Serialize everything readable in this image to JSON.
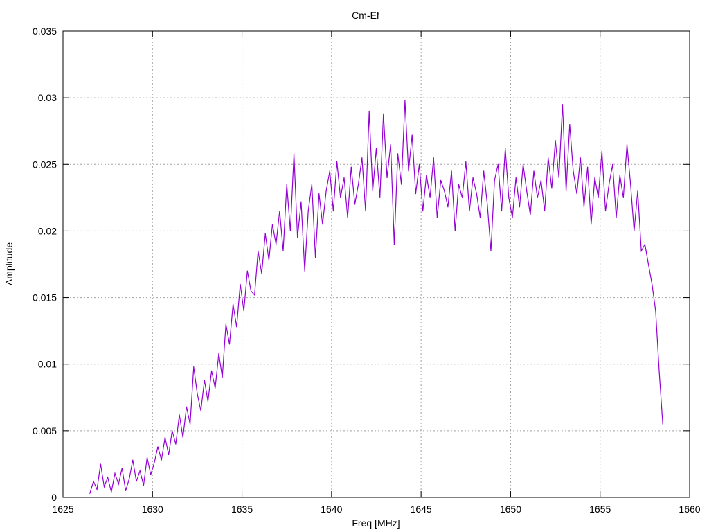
{
  "chart_data": {
    "type": "line",
    "title": "Cm-Ef",
    "xlabel": "Freq [MHz]",
    "ylabel": "Amplitude",
    "xlim": [
      1625,
      1660
    ],
    "ylim": [
      0,
      0.035
    ],
    "xticks": [
      "1625",
      "1630",
      "1635",
      "1640",
      "1645",
      "1650",
      "1655",
      "1660"
    ],
    "yticks": [
      "0",
      "0.005",
      "0.01",
      "0.015",
      "0.02",
      "0.025",
      "0.03",
      "0.035"
    ],
    "grid": true,
    "legend": "none",
    "series": [
      {
        "name": "Cm-Ef",
        "color": "#9400d3",
        "x_start": 1626.5,
        "x_step": 0.2,
        "values": [
          0.0003,
          0.0012,
          0.0006,
          0.0025,
          0.0008,
          0.0015,
          0.0004,
          0.0018,
          0.001,
          0.0022,
          0.0005,
          0.0014,
          0.0028,
          0.0012,
          0.002,
          0.0009,
          0.003,
          0.0017,
          0.0026,
          0.0038,
          0.0028,
          0.0045,
          0.0032,
          0.005,
          0.004,
          0.0062,
          0.0045,
          0.0068,
          0.0055,
          0.0098,
          0.0078,
          0.0065,
          0.0088,
          0.0072,
          0.0095,
          0.0082,
          0.0108,
          0.009,
          0.013,
          0.0115,
          0.0145,
          0.0128,
          0.016,
          0.014,
          0.017,
          0.0155,
          0.0152,
          0.0185,
          0.0168,
          0.0198,
          0.0178,
          0.0205,
          0.019,
          0.0215,
          0.0185,
          0.0235,
          0.02,
          0.0258,
          0.0195,
          0.0222,
          0.017,
          0.0215,
          0.0235,
          0.018,
          0.0228,
          0.0205,
          0.023,
          0.0245,
          0.0215,
          0.0252,
          0.0225,
          0.024,
          0.021,
          0.0248,
          0.022,
          0.0235,
          0.0255,
          0.0215,
          0.029,
          0.023,
          0.0262,
          0.0225,
          0.0288,
          0.024,
          0.0265,
          0.019,
          0.0258,
          0.0235,
          0.0298,
          0.0245,
          0.0272,
          0.0228,
          0.025,
          0.0215,
          0.0242,
          0.0225,
          0.0255,
          0.021,
          0.0238,
          0.023,
          0.0218,
          0.0245,
          0.02,
          0.0235,
          0.0225,
          0.0252,
          0.0215,
          0.024,
          0.0228,
          0.021,
          0.0245,
          0.022,
          0.0185,
          0.0238,
          0.025,
          0.0215,
          0.0262,
          0.0225,
          0.021,
          0.024,
          0.0218,
          0.025,
          0.023,
          0.0212,
          0.0245,
          0.0225,
          0.0238,
          0.0215,
          0.0255,
          0.0232,
          0.0268,
          0.024,
          0.0295,
          0.023,
          0.028,
          0.0245,
          0.0228,
          0.0255,
          0.0218,
          0.0248,
          0.0205,
          0.024,
          0.0225,
          0.026,
          0.0215,
          0.0235,
          0.025,
          0.021,
          0.0242,
          0.0225,
          0.0265,
          0.0235,
          0.02,
          0.023,
          0.0185,
          0.019,
          0.0175,
          0.016,
          0.014,
          0.0095,
          0.0055
        ]
      }
    ]
  }
}
